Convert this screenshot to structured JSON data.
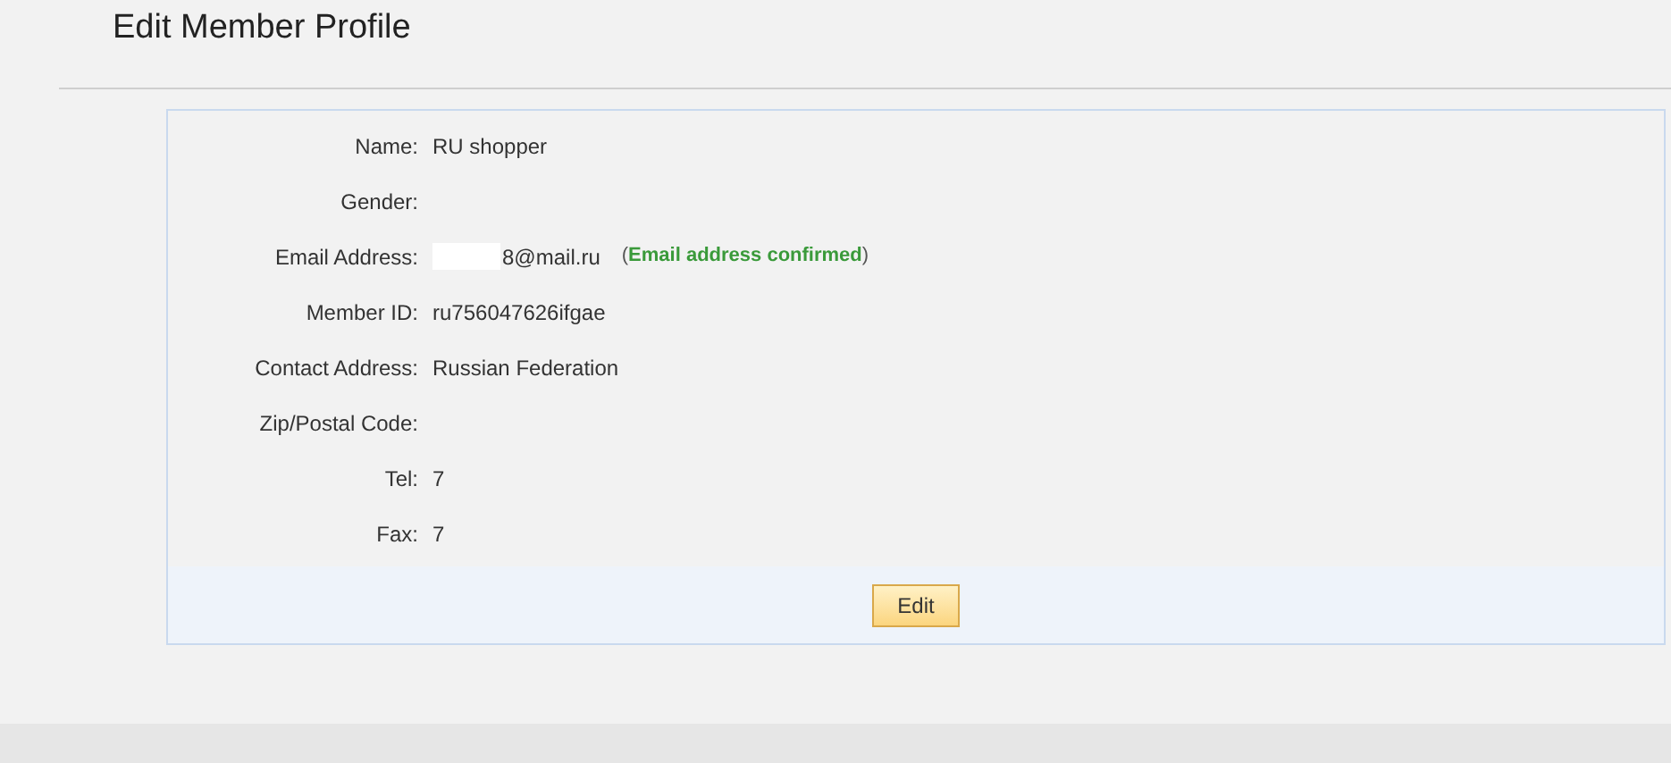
{
  "title": "Edit Member Profile",
  "fields": [
    {
      "label": "Name:",
      "value": "RU shopper"
    },
    {
      "label": "Gender:"
    },
    {
      "label": "Email Address:",
      "value": "8@mail.ru",
      "redacted": true,
      "note_open": "(",
      "note": "Email address confirmed",
      "note_close": ")"
    },
    {
      "label": "Member ID:",
      "value": "ru756047626ifgae"
    },
    {
      "label": "Contact Address:",
      "value": "Russian Federation"
    },
    {
      "label": "Zip/Postal Code:"
    },
    {
      "label": "Tel:",
      "value": "7"
    },
    {
      "label": "Fax:",
      "value": "7"
    }
  ],
  "edit_button": "Edit"
}
